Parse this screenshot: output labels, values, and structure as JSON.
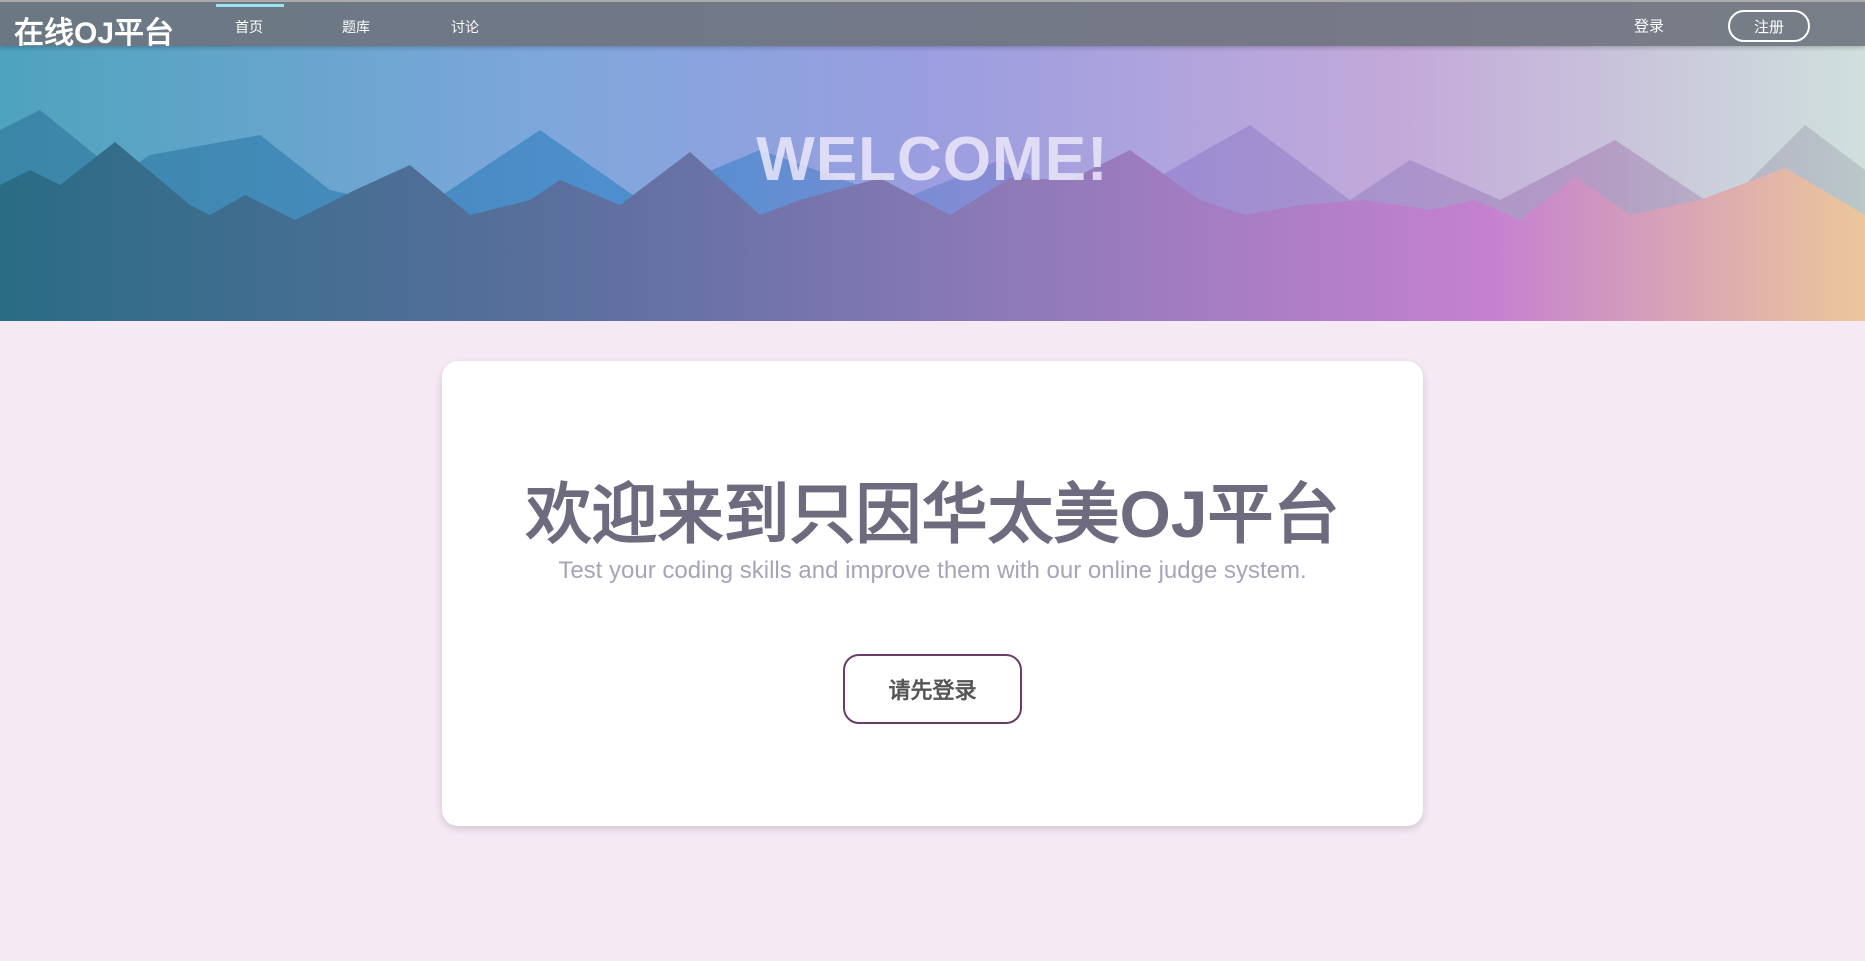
{
  "nav": {
    "logo": "在线OJ平台",
    "links": [
      {
        "label": "首页",
        "active": true
      },
      {
        "label": "题库"
      },
      {
        "label": "讨论"
      }
    ],
    "login_label": "登录",
    "register_label": "注册"
  },
  "banner": {
    "headline": "WELCOME!"
  },
  "card": {
    "title": "欢迎来到只因华太美OJ平台",
    "subtitle": "Test your coding skills and improve them with our online judge system.",
    "button_label": "请先登录"
  },
  "colors": {
    "accent_bar": "#9ee2ef",
    "button_border": "#6a3d68",
    "page_bg": "#f5e9f4"
  }
}
